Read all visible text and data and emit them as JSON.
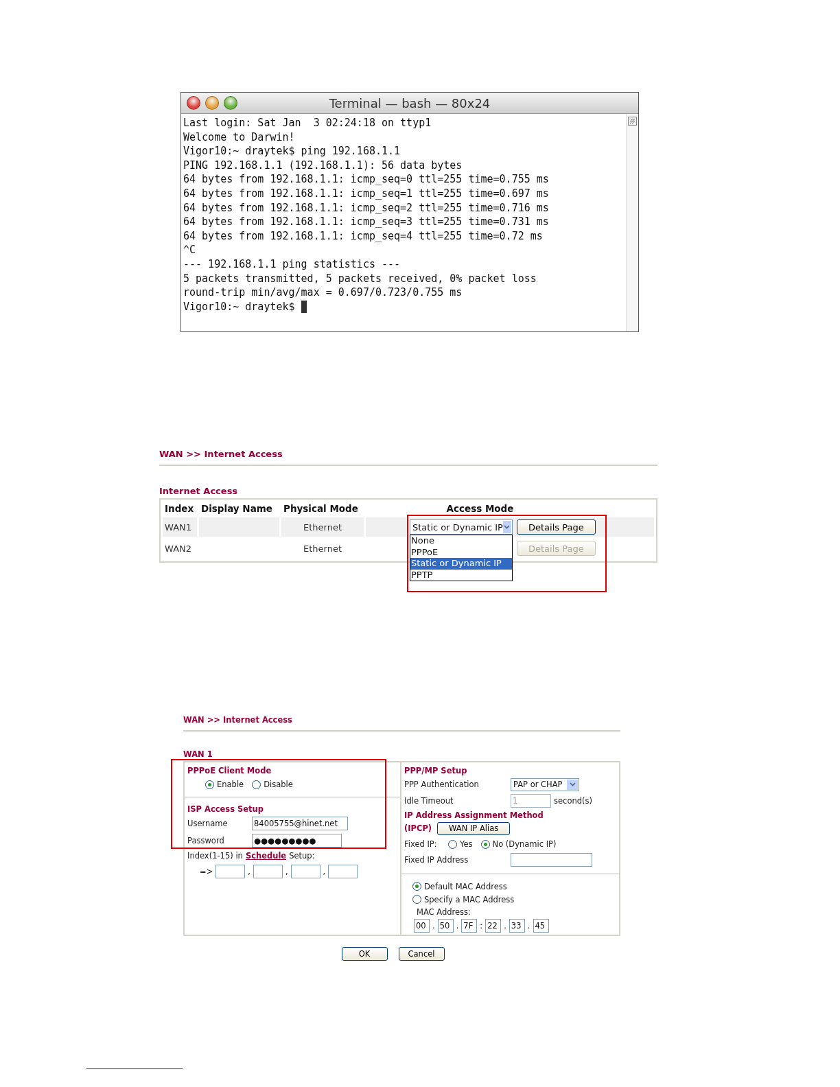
{
  "terminal": {
    "title": "Terminal — bash — 80x24",
    "lines": [
      "Last login: Sat Jan  3 02:24:18 on ttyp1",
      "Welcome to Darwin!",
      "Vigor10:~ draytek$ ping 192.168.1.1",
      "PING 192.168.1.1 (192.168.1.1): 56 data bytes",
      "64 bytes from 192.168.1.1: icmp_seq=0 ttl=255 time=0.755 ms",
      "64 bytes from 192.168.1.1: icmp_seq=1 ttl=255 time=0.697 ms",
      "64 bytes from 192.168.1.1: icmp_seq=2 ttl=255 time=0.716 ms",
      "64 bytes from 192.168.1.1: icmp_seq=3 ttl=255 time=0.731 ms",
      "64 bytes from 192.168.1.1: icmp_seq=4 ttl=255 time=0.72 ms",
      "^C",
      "--- 192.168.1.1 ping statistics ---",
      "5 packets transmitted, 5 packets received, 0% packet loss",
      "round-trip min/avg/max = 0.697/0.723/0.755 ms",
      "Vigor10:~ draytek$"
    ]
  },
  "access_overview": {
    "breadcrumb": "WAN >> Internet Access",
    "section_title": "Internet Access",
    "highlighted": true,
    "columns": [
      "Index",
      "Display Name",
      "Physical Mode",
      "Access Mode"
    ],
    "rows": [
      {
        "index": "WAN1",
        "physical_mode": "Ethernet",
        "access_mode": "Static or Dynamic IP",
        "details_button": "Details Page",
        "disabled": false
      },
      {
        "index": "WAN2",
        "physical_mode": "Ethernet",
        "details_button": "Details Page",
        "disabled": true
      }
    ],
    "dropdown_options": [
      {
        "label": "None",
        "selected": false
      },
      {
        "label": "PPPoE",
        "selected": false
      },
      {
        "label": "Static or Dynamic IP",
        "selected": true
      },
      {
        "label": "PPTP",
        "selected": false
      }
    ]
  },
  "wan_detail": {
    "breadcrumb": "WAN >> Internet Access",
    "section_title": "WAN 1",
    "pppoe": {
      "title": "PPPoE Client Mode",
      "highlighted": true,
      "options": [
        {
          "label": "Enable",
          "selected": true
        },
        {
          "label": "Disable",
          "selected": false
        }
      ]
    },
    "isp": {
      "title": "ISP Access Setup",
      "username_label": "Username",
      "username": "84005755@hinet.net",
      "password_label": "Password",
      "password": "●●●●●●●●●"
    },
    "schedule": {
      "prefix": "Index(1-15) in",
      "link": "Schedule",
      "suffix": "Setup:",
      "arrow": "=>",
      "separators": [
        ",",
        ",",
        ","
      ]
    },
    "ppp": {
      "title": "PPP/MP Setup",
      "auth_label": "PPP Authentication",
      "auth_value": "PAP or CHAP",
      "idle_label": "Idle Timeout",
      "idle_value": "1",
      "idle_disabled": true,
      "idle_unit": "second(s)",
      "ip_title": "IP Address Assignment Method",
      "ipcp": "(IPCP)",
      "alias_button": "WAN IP Alias",
      "fixed_ip_label": "Fixed IP:",
      "fixed_ip_options": [
        {
          "label": "Yes",
          "selected": false
        },
        {
          "label": "No (Dynamic IP)",
          "selected": true
        }
      ],
      "fixed_address_label": "Fixed IP Address"
    },
    "mac": {
      "options": [
        {
          "label": "Default MAC Address",
          "selected": true
        },
        {
          "label": "Specify a MAC Address",
          "selected": false
        }
      ],
      "label": "MAC Address:",
      "octets": [
        "00",
        "50",
        "7F",
        "22",
        "33",
        "45"
      ],
      "separators": [
        ".",
        ".",
        ":",
        ".",
        "."
      ]
    },
    "buttons": [
      "OK",
      "Cancel"
    ]
  }
}
